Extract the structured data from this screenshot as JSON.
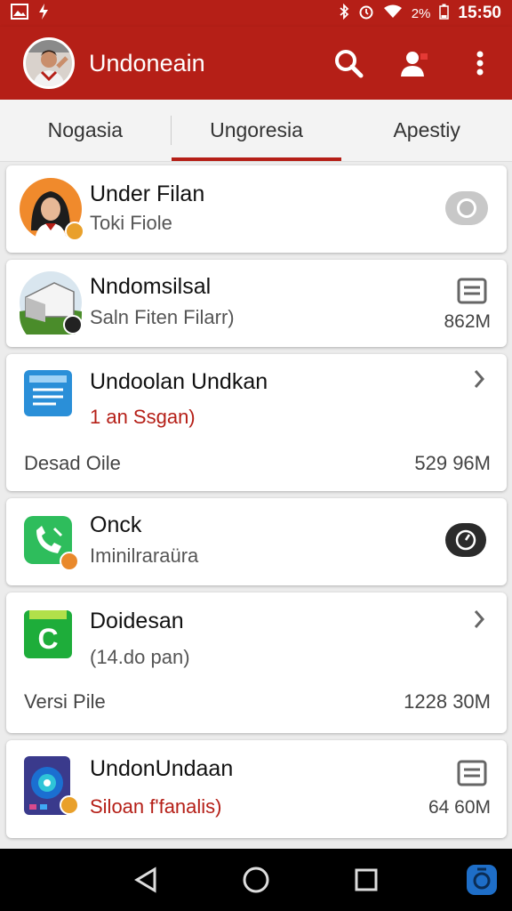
{
  "status_bar": {
    "battery": "2%",
    "time": "15:50",
    "icons": [
      "image-icon",
      "bolt-icon",
      "bluetooth-icon",
      "alarm-icon",
      "wifi-icon",
      "battery-icon"
    ]
  },
  "app_bar": {
    "title": "Undoneain",
    "actions": [
      "search-icon",
      "add-contact-icon",
      "more-vert-icon"
    ],
    "color": "#b51f17"
  },
  "tabs": [
    {
      "label": "Nogasia",
      "active": false
    },
    {
      "label": "Ungoresia",
      "active": true
    },
    {
      "label": "Apestiy",
      "active": false
    }
  ],
  "items": [
    {
      "title": "Under Filan",
      "subtitle": "Toki Fiole",
      "right_icon": "toggle-icon"
    },
    {
      "title": "Nndomsilsal",
      "subtitle": "Saln Fiten Filarr)",
      "right_icon": "document-icon",
      "size": "862M"
    },
    {
      "title": "Undoolan Undkan",
      "subtitle": "1 an Ssgan)",
      "right_icon": "chevron-right-icon",
      "footer_left": "Desad Oile",
      "footer_right": "529 96M"
    },
    {
      "title": "Onck",
      "subtitle": "Iminilraraüra",
      "right_icon": "timer-icon"
    },
    {
      "title": "Doidesan",
      "subtitle": "(14.do pan)",
      "right_icon": "chevron-right-icon",
      "footer_left": "Versi Pile",
      "footer_right": "1228 30M"
    },
    {
      "title": "UndonUndaan",
      "subtitle": "Siloan f'fanalis)",
      "right_icon": "document-icon",
      "size": "64 60M"
    }
  ],
  "nav_bar": [
    "back-icon",
    "home-icon",
    "recents-icon",
    "assistant-icon"
  ]
}
